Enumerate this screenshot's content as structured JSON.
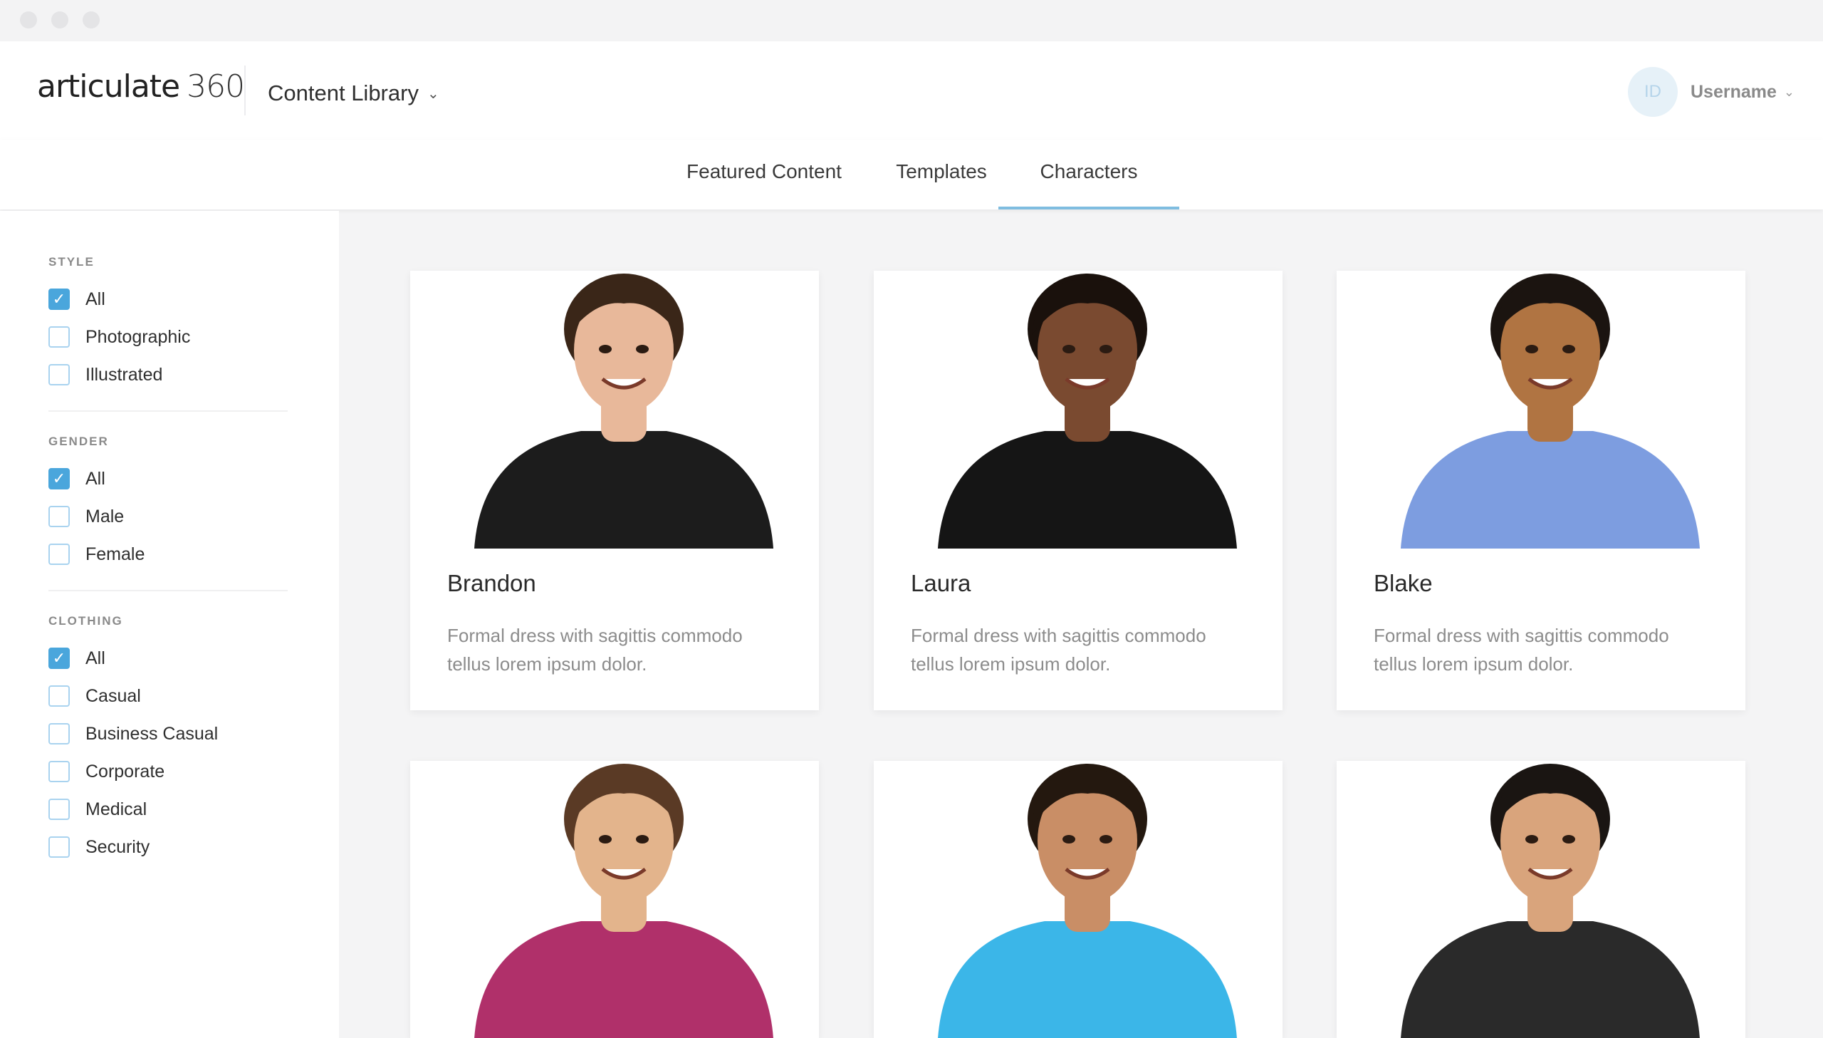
{
  "app": {
    "logo_text": "articulate",
    "logo_number": "360",
    "library_menu_label": "Content Library",
    "user": {
      "initials": "ID",
      "name": "Username"
    }
  },
  "tabs": [
    {
      "label": "Featured Content",
      "active": false
    },
    {
      "label": "Templates",
      "active": false
    },
    {
      "label": "Characters",
      "active": true
    }
  ],
  "filters": {
    "style": {
      "title": "STYLE",
      "options": [
        {
          "label": "All",
          "checked": true
        },
        {
          "label": "Photographic",
          "checked": false
        },
        {
          "label": "Illustrated",
          "checked": false
        }
      ]
    },
    "gender": {
      "title": "GENDER",
      "options": [
        {
          "label": "All",
          "checked": true
        },
        {
          "label": "Male",
          "checked": false
        },
        {
          "label": "Female",
          "checked": false
        }
      ]
    },
    "clothing": {
      "title": "CLOTHING",
      "options": [
        {
          "label": "All",
          "checked": true
        },
        {
          "label": "Casual",
          "checked": false
        },
        {
          "label": "Business Casual",
          "checked": false
        },
        {
          "label": "Corporate",
          "checked": false
        },
        {
          "label": "Medical",
          "checked": false
        },
        {
          "label": "Security",
          "checked": false
        }
      ]
    }
  },
  "characters": [
    {
      "name": "Brandon",
      "description": "Formal dress with sagittis commodo tellus lorem ipsum dolor.",
      "style": "photographic",
      "skin": "#e8b89a",
      "hair": "#3a2618",
      "top": "#1c1c1c"
    },
    {
      "name": "Laura",
      "description": "Formal dress with sagittis commodo tellus lorem ipsum dolor.",
      "style": "photographic",
      "skin": "#7a4a30",
      "hair": "#1a110c",
      "top": "#151515"
    },
    {
      "name": "Blake",
      "description": "Formal dress with sagittis commodo tellus lorem ipsum dolor.",
      "style": "illustrated",
      "skin": "#b07442",
      "hair": "#1b1410",
      "top": "#7d9de0"
    },
    {
      "name": "",
      "description": "",
      "style": "illustrated",
      "skin": "#e3b48c",
      "hair": "#5a3a25",
      "top": "#b0306a"
    },
    {
      "name": "",
      "description": "",
      "style": "photographic",
      "skin": "#c98e66",
      "hair": "#24180f",
      "top": "#3bb6e8"
    },
    {
      "name": "",
      "description": "",
      "style": "photographic",
      "skin": "#d9a47c",
      "hair": "#1a1512",
      "top": "#2a2a2a"
    }
  ],
  "colors": {
    "accent": "#4aa6dc",
    "tab_underline": "#7fbde0",
    "background": "#f4f4f5"
  }
}
